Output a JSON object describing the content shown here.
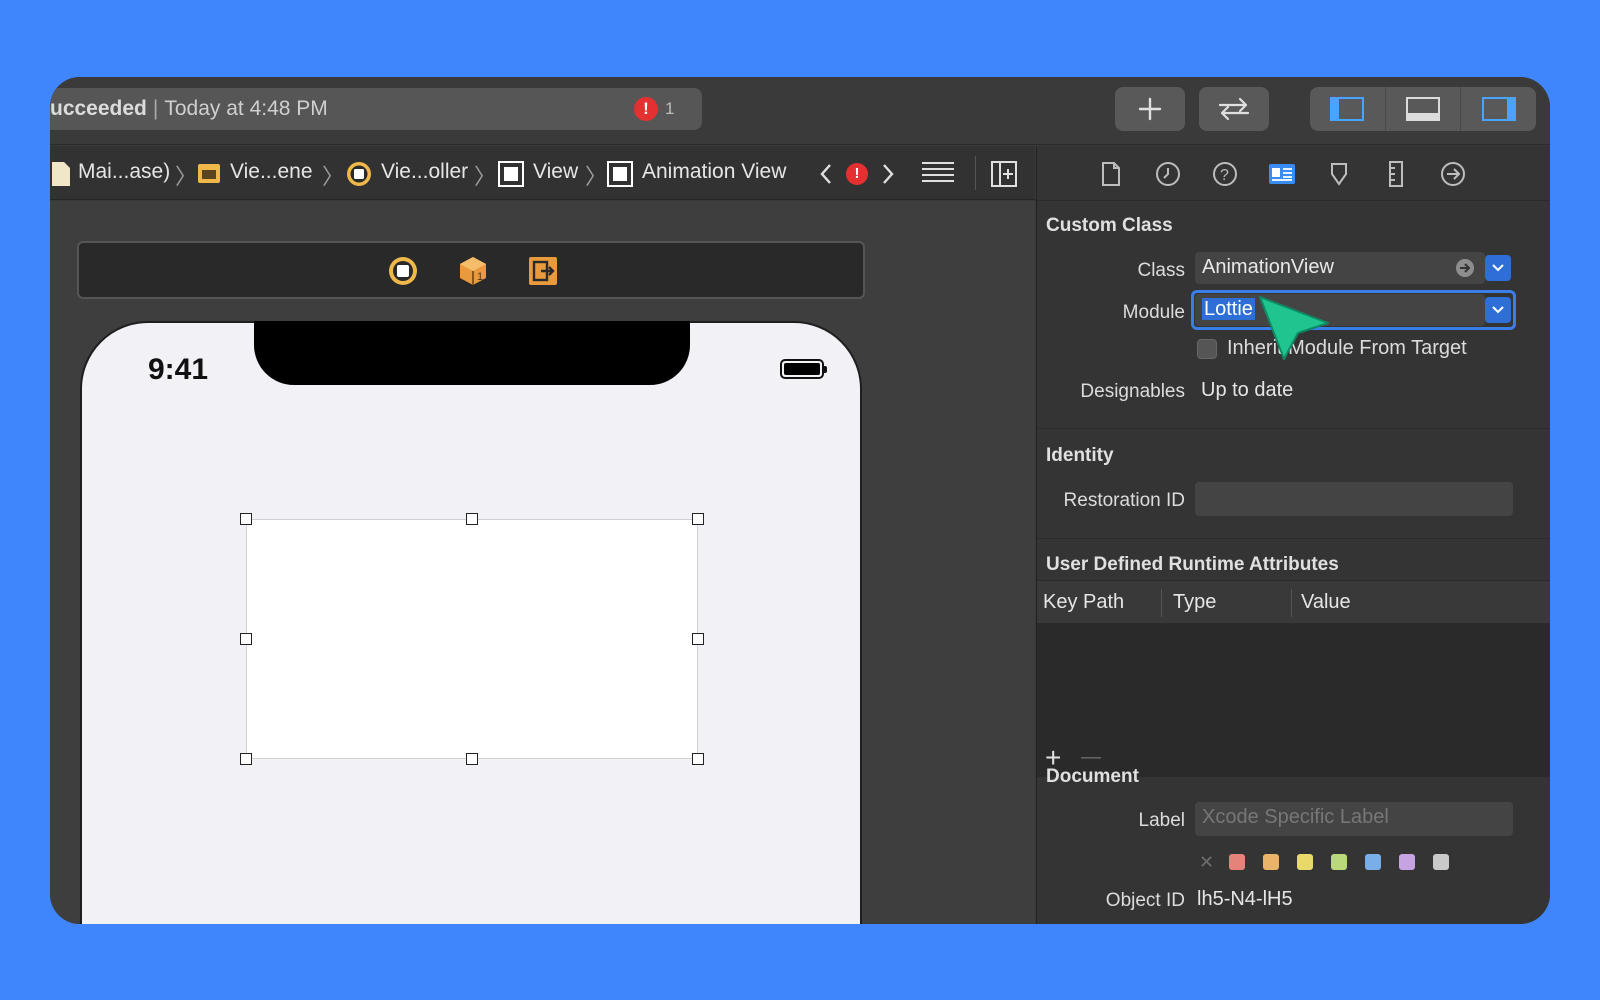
{
  "toolbar": {
    "status_prefix": "ucceeded",
    "status_separator": "|",
    "status_time": "Today at 4:48 PM",
    "error_badge": "!",
    "error_count": "1",
    "add_icon": "plus-icon",
    "swap_icon": "arrows-swap-icon",
    "layout_icons": [
      "left-panel-icon",
      "bottom-panel-icon",
      "right-panel-icon"
    ]
  },
  "jumpbar": {
    "crumbs": [
      "Mai...ase)",
      "Vie...ene",
      "Vie...oller",
      "View",
      "Animation View"
    ],
    "error_badge": "!"
  },
  "canvas": {
    "time": "9:41"
  },
  "inspector": {
    "custom_class": {
      "title": "Custom Class",
      "class_label": "Class",
      "class_value": "AnimationView",
      "module_label": "Module",
      "module_value": "Lottie",
      "inherit_label": "Inherit Module From Target",
      "designables_label": "Designables",
      "designables_value": "Up to date"
    },
    "identity": {
      "title": "Identity",
      "restoration_label": "Restoration ID",
      "restoration_value": ""
    },
    "runtime_attributes": {
      "title": "User Defined Runtime Attributes",
      "columns": [
        "Key Path",
        "Type",
        "Value"
      ],
      "add": "+",
      "remove": "—"
    },
    "document": {
      "title": "Document",
      "label_label": "Label",
      "label_placeholder": "Xcode Specific Label",
      "clear_glyph": "✕",
      "swatch_colors": [
        "#e5837a",
        "#e9b46a",
        "#e9d96c",
        "#b9d97a",
        "#7aaee9",
        "#c6a3e3",
        "#c9c9c9"
      ],
      "object_id_label": "Object ID",
      "object_id_value": "lh5-N4-lH5"
    }
  },
  "colors": {
    "background": "#3f86fc",
    "accent": "#2d6fd6",
    "cursor": "#1fc48f"
  }
}
